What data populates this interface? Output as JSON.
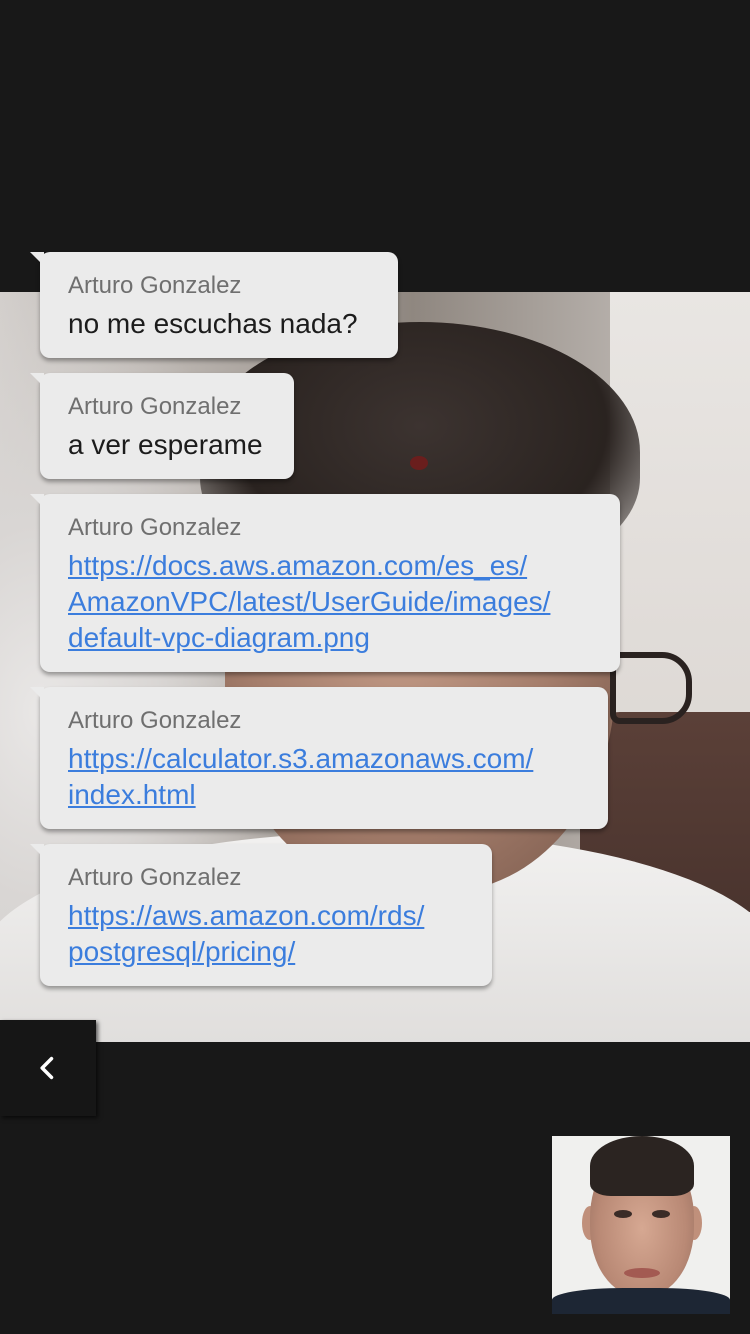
{
  "messages": [
    {
      "sender": "Arturo Gonzalez",
      "text": "no me escuchas nada?"
    },
    {
      "sender": "Arturo Gonzalez",
      "text": "a ver esperame"
    },
    {
      "sender": "Arturo Gonzalez",
      "link": "https://docs.aws.amazon.com/es_es/\nAmazonVPC/latest/UserGuide/images/\ndefault-vpc-diagram.png"
    },
    {
      "sender": "Arturo Gonzalez",
      "link": "https://calculator.s3.amazonaws.com/\nindex.html"
    },
    {
      "sender": "Arturo Gonzalez",
      "link": "https://aws.amazon.com/rds/\npostgresql/pricing/"
    }
  ],
  "controls": {
    "back_icon": "chevron-left-icon"
  },
  "colors": {
    "background": "#181818",
    "bubble": "#ebebeb",
    "sender_text": "#6f6f6f",
    "message_text": "#1c1c1c",
    "link": "#3b7ddd"
  }
}
